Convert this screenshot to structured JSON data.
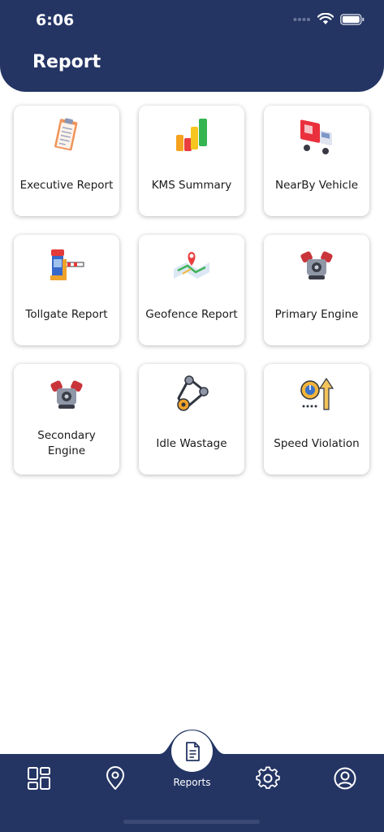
{
  "status_bar": {
    "time": "6:06"
  },
  "header": {
    "title": "Report"
  },
  "reports": [
    {
      "label": "Executive Report",
      "icon": "clipboard-icon"
    },
    {
      "label": "KMS Summary",
      "icon": "bar-chart-icon"
    },
    {
      "label": "NearBy Vehicle",
      "icon": "truck-icon"
    },
    {
      "label": "Tollgate Report",
      "icon": "tollgate-icon"
    },
    {
      "label": "Geofence Report",
      "icon": "map-pin-icon"
    },
    {
      "label": "Primary Engine",
      "icon": "engine-icon"
    },
    {
      "label": "Secondary Engine",
      "icon": "engine-icon"
    },
    {
      "label": "Idle Wastage",
      "icon": "belt-pulley-icon"
    },
    {
      "label": "Speed Violation",
      "icon": "speed-arrow-icon"
    }
  ],
  "bottom_nav": {
    "active_label": "Reports",
    "items": [
      {
        "icon": "dashboard-grid-icon"
      },
      {
        "icon": "location-pin-icon"
      },
      {
        "icon": "document-icon"
      },
      {
        "icon": "settings-gear-icon"
      },
      {
        "icon": "profile-icon"
      }
    ]
  },
  "colors": {
    "primary": "#243564",
    "background": "#ffffff"
  }
}
